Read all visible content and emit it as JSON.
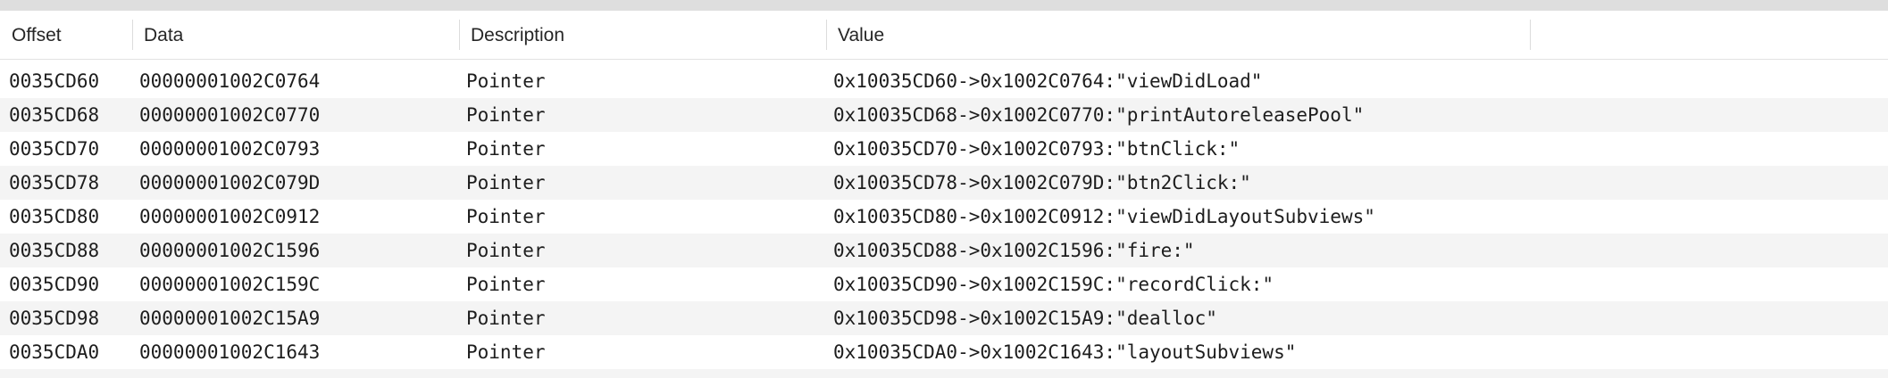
{
  "columns": {
    "offset": "Offset",
    "data": "Data",
    "description": "Description",
    "value": "Value"
  },
  "rows": [
    {
      "offset": "0035CD60",
      "data": "00000001002C0764",
      "description": "Pointer",
      "value": "0x10035CD60->0x1002C0764:\"viewDidLoad\""
    },
    {
      "offset": "0035CD68",
      "data": "00000001002C0770",
      "description": "Pointer",
      "value": "0x10035CD68->0x1002C0770:\"printAutoreleasePool\""
    },
    {
      "offset": "0035CD70",
      "data": "00000001002C0793",
      "description": "Pointer",
      "value": "0x10035CD70->0x1002C0793:\"btnClick:\""
    },
    {
      "offset": "0035CD78",
      "data": "00000001002C079D",
      "description": "Pointer",
      "value": "0x10035CD78->0x1002C079D:\"btn2Click:\""
    },
    {
      "offset": "0035CD80",
      "data": "00000001002C0912",
      "description": "Pointer",
      "value": "0x10035CD80->0x1002C0912:\"viewDidLayoutSubviews\""
    },
    {
      "offset": "0035CD88",
      "data": "00000001002C1596",
      "description": "Pointer",
      "value": "0x10035CD88->0x1002C1596:\"fire:\""
    },
    {
      "offset": "0035CD90",
      "data": "00000001002C159C",
      "description": "Pointer",
      "value": "0x10035CD90->0x1002C159C:\"recordClick:\""
    },
    {
      "offset": "0035CD98",
      "data": "00000001002C15A9",
      "description": "Pointer",
      "value": "0x10035CD98->0x1002C15A9:\"dealloc\""
    },
    {
      "offset": "0035CDA0",
      "data": "00000001002C1643",
      "description": "Pointer",
      "value": "0x10035CDA0->0x1002C1643:\"layoutSubviews\""
    }
  ]
}
